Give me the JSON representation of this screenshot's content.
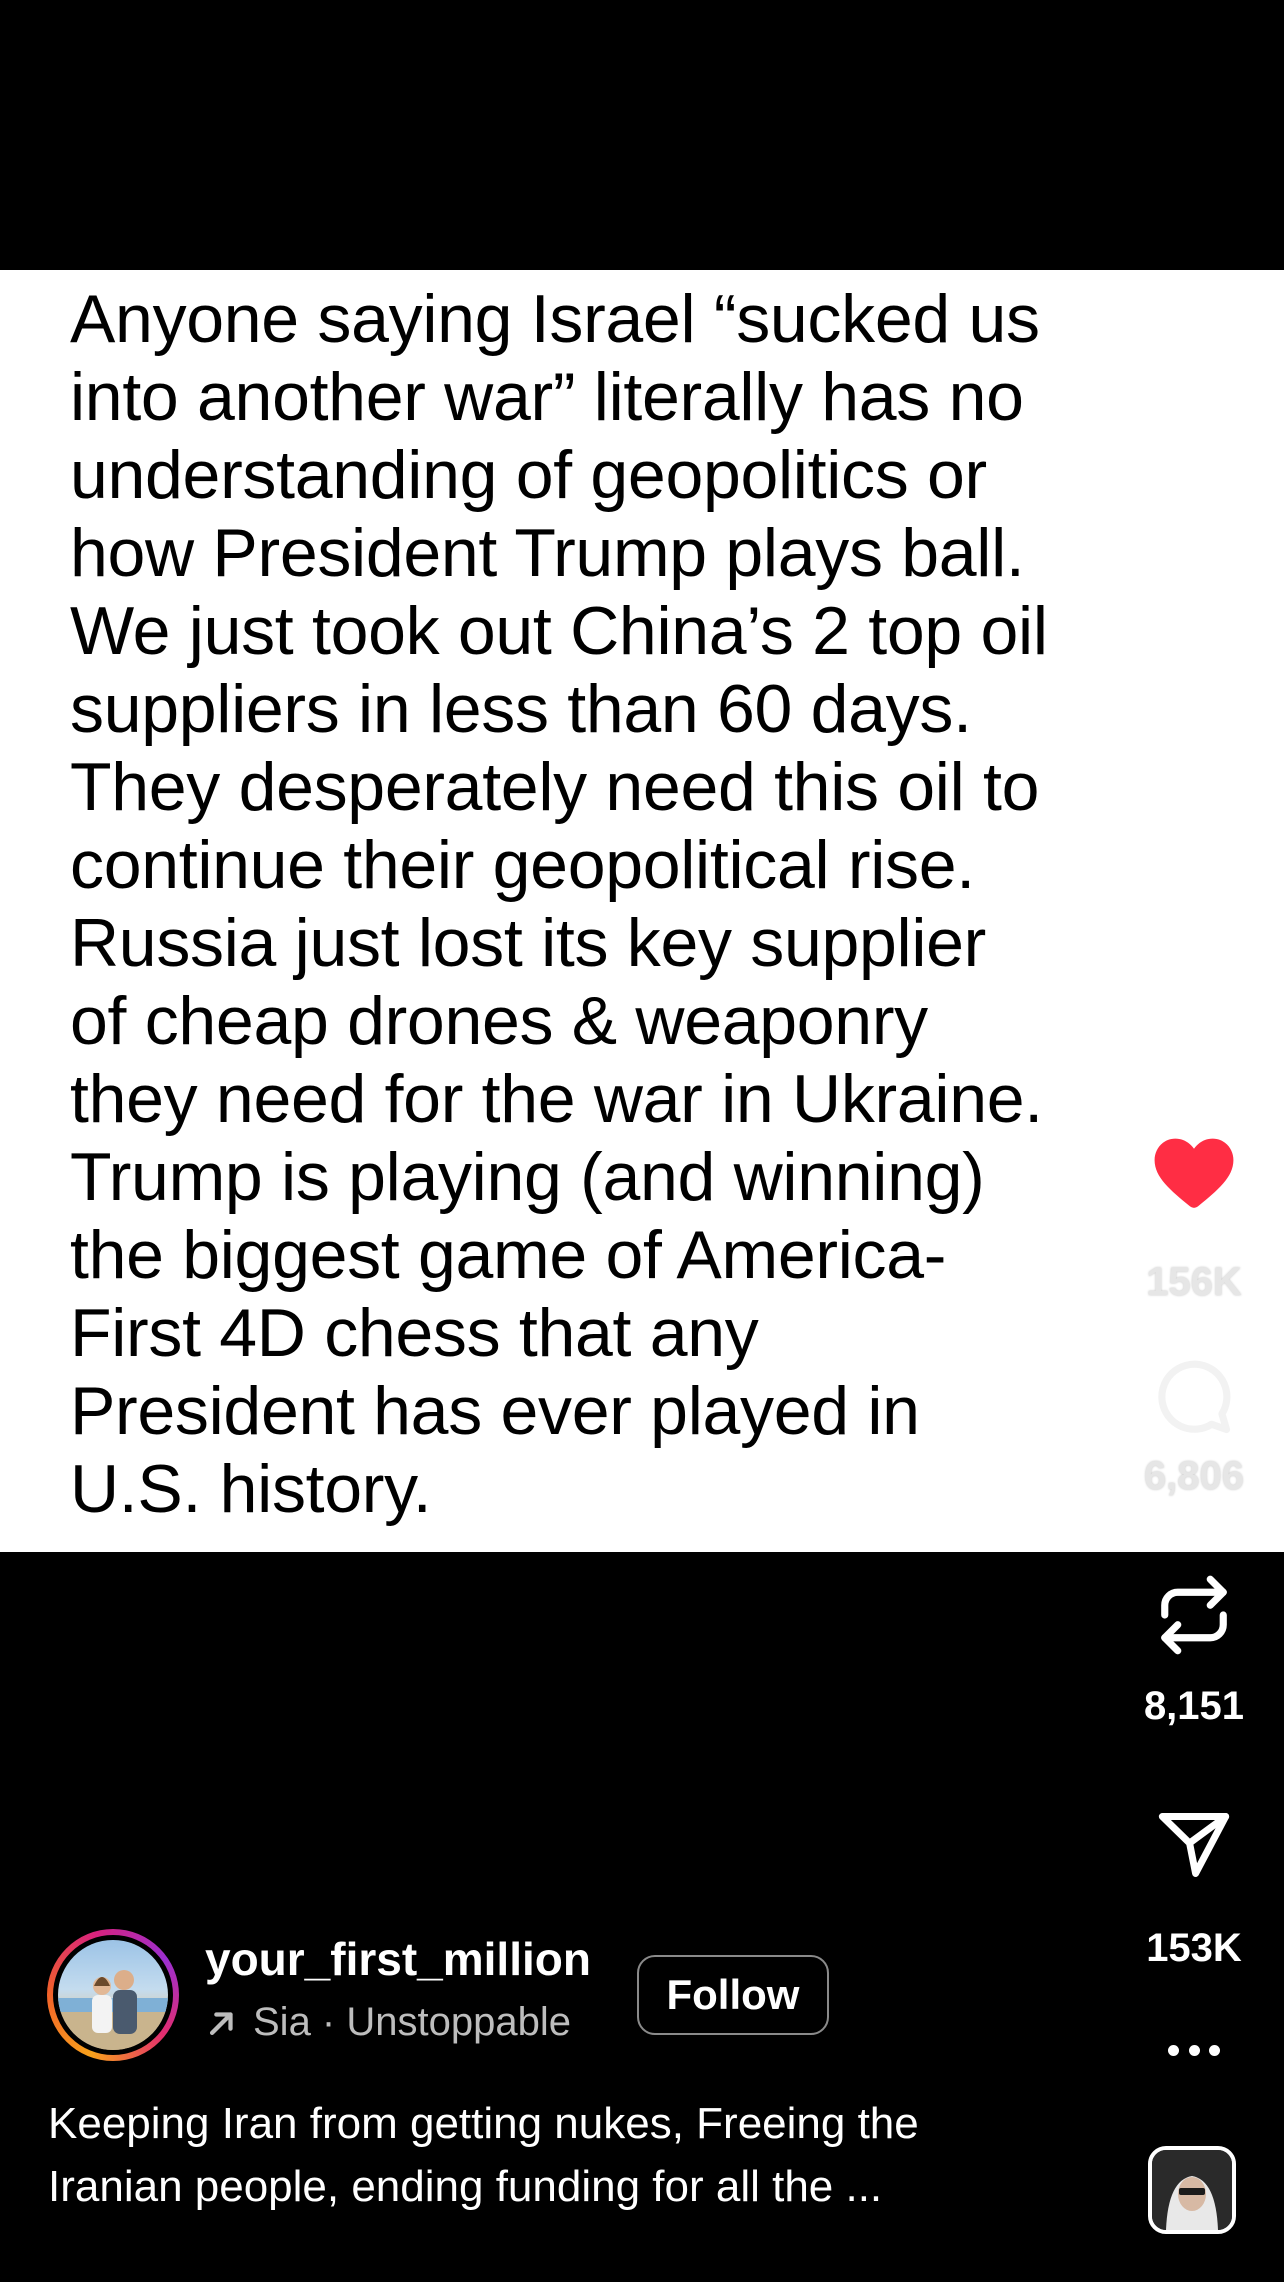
{
  "post": {
    "text_lines": [
      "Anyone saying Israel “sucked us",
      "into another war” literally has no",
      "understanding of geopolitics or",
      "how President Trump plays ball.",
      "We just took out China’s 2 top oil",
      "suppliers in less than 60 days.",
      "They desperately need this oil to",
      "continue their geopolitical rise.",
      "Russia just lost its key supplier",
      "of cheap drones & weaponry",
      "they need for the war in Ukraine.",
      "Trump is playing (and winning)",
      "the biggest game of America-",
      "First 4D chess that any",
      "President has ever played in",
      "U.S. history."
    ]
  },
  "actions": {
    "like": {
      "icon": "heart-icon",
      "count": "156K",
      "color": "#ff2d44"
    },
    "comment": {
      "icon": "comment-icon",
      "count": "6,806"
    },
    "repost": {
      "icon": "repost-icon",
      "count": "8,151"
    },
    "share": {
      "icon": "send-icon",
      "count": "153K"
    },
    "more": {
      "icon": "more-dots-icon"
    }
  },
  "author": {
    "username": "your_first_million",
    "audio": "Sia · Unstoppable",
    "follow_label": "Follow"
  },
  "caption": {
    "lines": [
      "Keeping Iran from getting nukes, Freeing the",
      "Iranian people, ending funding for all the ..."
    ]
  },
  "colors": {
    "background": "#000000",
    "text": "#ffffff",
    "post_background": "#ffffff",
    "like": "#ff2d44"
  }
}
